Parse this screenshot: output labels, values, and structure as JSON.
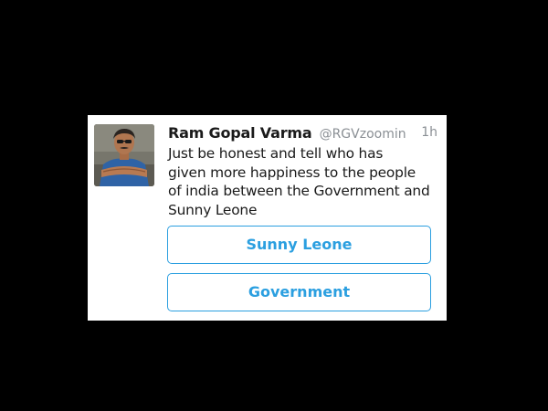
{
  "tweet": {
    "author": {
      "display_name": "Ram Gopal Varma",
      "handle": "@RGVzoomin"
    },
    "timestamp": "1h",
    "text_lines": [
      "Just be honest and tell who has",
      "given more happiness to the people",
      "of india between the Government and",
      "Sunny Leone"
    ],
    "poll": {
      "options": [
        {
          "label": "Sunny Leone"
        },
        {
          "label": "Government"
        }
      ]
    }
  },
  "colors": {
    "background": "#000000",
    "card": "#ffffff",
    "text": "#1a1a1a",
    "muted": "#8a8f94",
    "accent": "#2b9fe0"
  }
}
